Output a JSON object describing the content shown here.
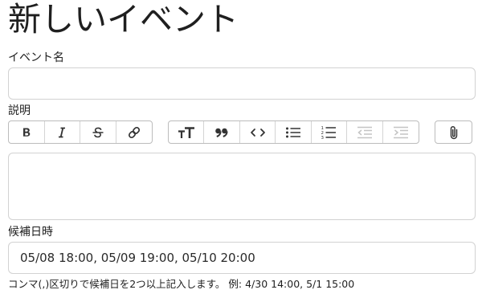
{
  "page": {
    "title": "新しいイベント"
  },
  "event_name": {
    "label": "イベント名",
    "value": "",
    "placeholder": ""
  },
  "description": {
    "label": "説明",
    "value": "",
    "toolbar": {
      "groups": [
        [
          "bold-icon",
          "italic-icon",
          "strikethrough-icon",
          "link-icon"
        ],
        [
          "heading-icon",
          "quote-icon",
          "code-icon",
          "bullet-list-icon",
          "numbered-list-icon",
          "outdent-icon",
          "indent-icon"
        ],
        [
          "attach-icon"
        ]
      ],
      "disabled": [
        "outdent-icon",
        "indent-icon"
      ]
    }
  },
  "candidate_dates": {
    "label": "候補日時",
    "value": "05/08 18:00, 05/09 19:00, 05/10 20:00",
    "hint": "コンマ(,)区切りで候補日を2つ以上記入します。 例: 4/30 14:00, 5/1 15:00"
  },
  "colors": {
    "border": "#d2d2d2",
    "toolbar_border": "#bcbcbc",
    "icon": "#333333",
    "icon_disabled": "#c4c4c4"
  }
}
